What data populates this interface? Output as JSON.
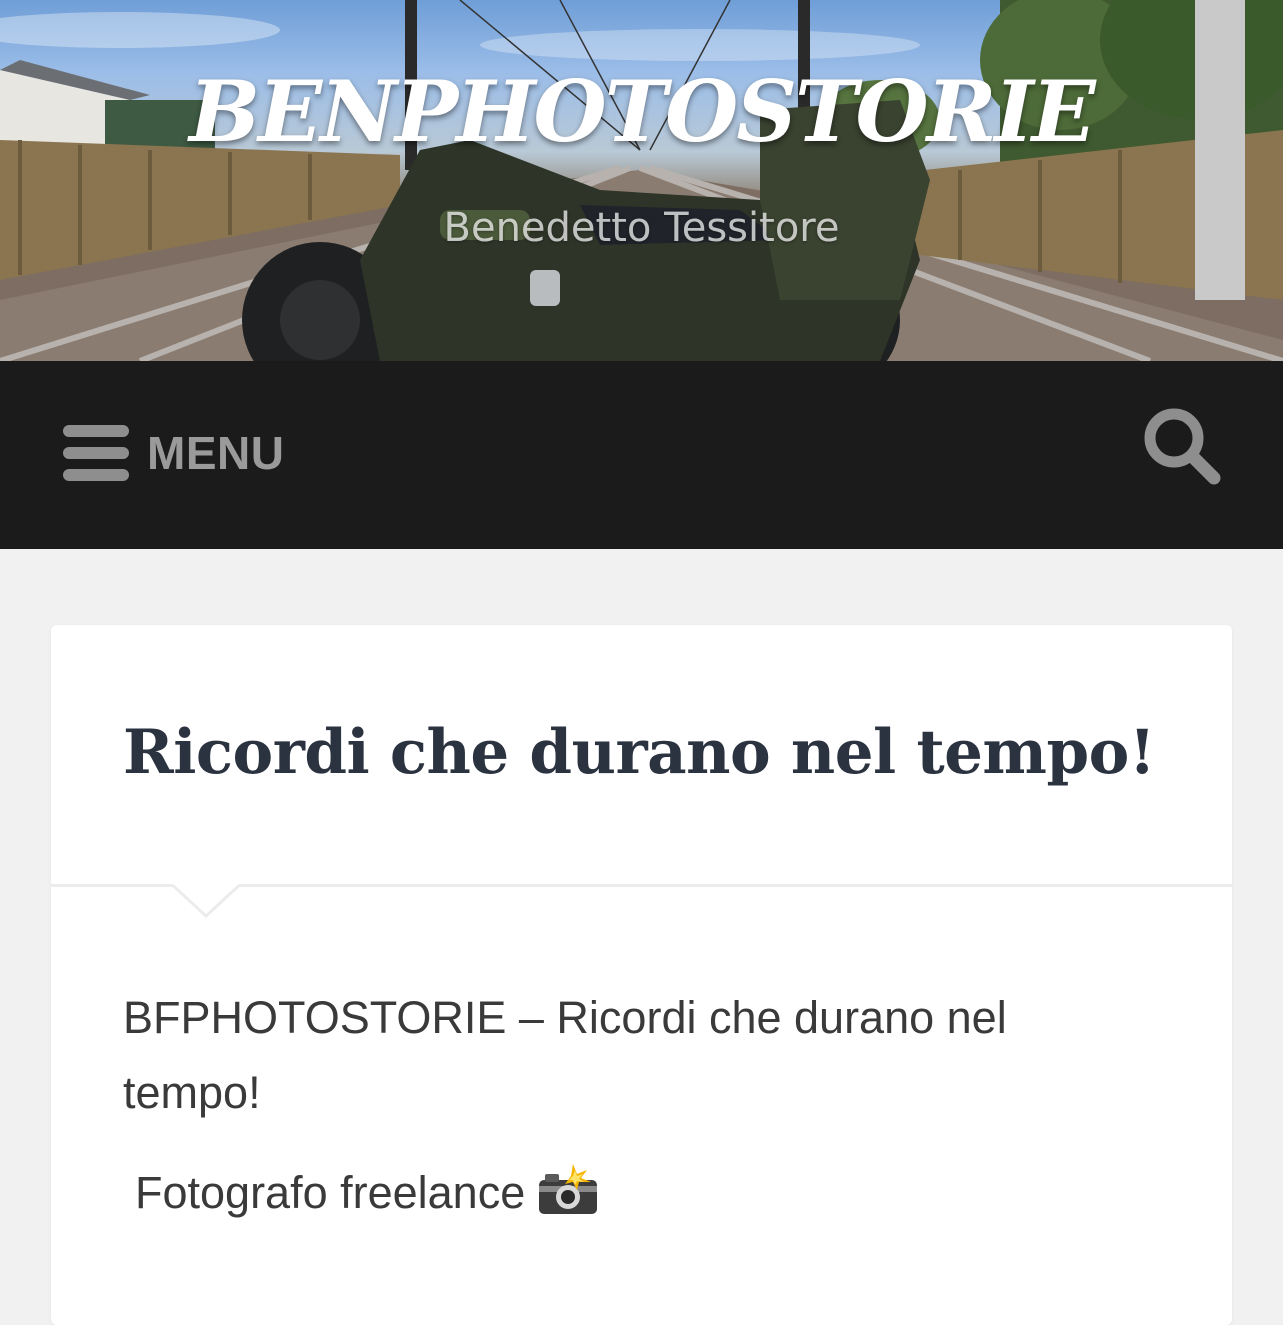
{
  "header": {
    "site_title": "BENPHOTOSTORIE",
    "tagline": "Benedetto Tessitore",
    "background_image": "motorcycle-on-railway-tracks"
  },
  "navbar": {
    "menu_label": "MENU",
    "menu_icon": "hamburger-icon",
    "search_icon": "search-icon"
  },
  "post": {
    "title": "Ricordi che durano nel tempo!",
    "paragraphs": [
      "BFPHOTOSTORIE – Ricordi che durano nel tempo!",
      "Fotografo freelance"
    ],
    "emoji_icon": "camera-with-flash-icon"
  },
  "colors": {
    "navbar_bg": "#1b1b1b",
    "page_bg": "#f1f1f1",
    "card_bg": "#ffffff",
    "title_color": "#2b3240",
    "body_text": "#3a3a3a",
    "nav_text": "#9a9a9a"
  }
}
